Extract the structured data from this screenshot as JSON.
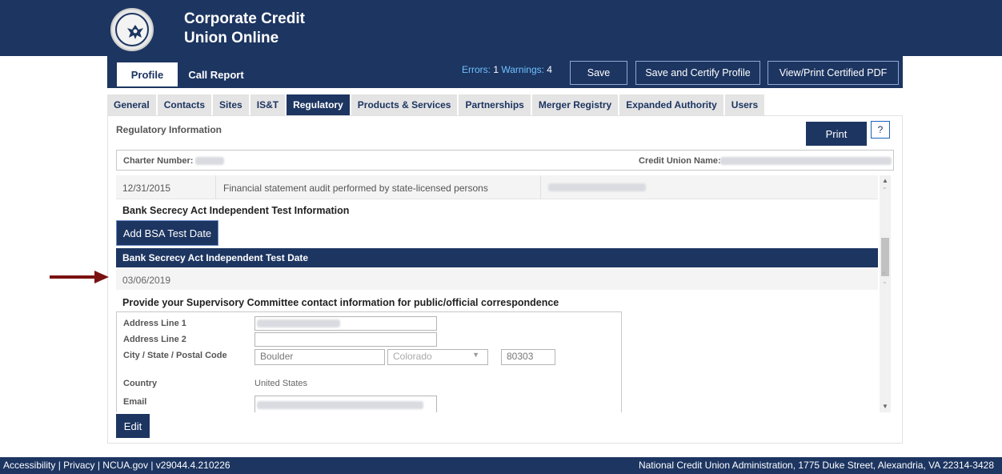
{
  "header": {
    "title_line1": "Corporate Credit",
    "title_line2": "Union Online",
    "tabs": [
      {
        "label": "Profile"
      },
      {
        "label": "Call Report"
      }
    ],
    "errors_label": "Errors:",
    "errors_count": "1",
    "warnings_label": "Warnings:",
    "warnings_count": "4",
    "save_label": "Save",
    "save_certify_label": "Save and Certify Profile",
    "view_print_label": "View/Print Certified PDF"
  },
  "subtabs": [
    {
      "label": "General"
    },
    {
      "label": "Contacts"
    },
    {
      "label": "Sites"
    },
    {
      "label": "IS&T"
    },
    {
      "label": "Regulatory"
    },
    {
      "label": "Products & Services"
    },
    {
      "label": "Partnerships"
    },
    {
      "label": "Merger Registry"
    },
    {
      "label": "Expanded Authority"
    },
    {
      "label": "Users"
    }
  ],
  "panel": {
    "section_title": "Regulatory Information",
    "print_label": "Print",
    "help_label": "?",
    "charter_label": "Charter Number:",
    "cu_name_label": "Credit Union Name:",
    "audit_row": {
      "date": "12/31/2015",
      "text": "Financial statement audit performed by state-licensed persons"
    },
    "bsa_heading": "Bank Secrecy Act Independent Test Information",
    "add_bsa_label": "Add BSA Test Date",
    "bsa_column": "Bank Secrecy Act Independent Test Date",
    "bsa_date": "03/06/2019",
    "supervisory_heading": "Provide your Supervisory Committee contact information for public/official correspondence",
    "fields": {
      "address1_label": "Address Line 1",
      "address2_label": "Address Line 2",
      "city_state_label": "City / State / Postal Code",
      "city_value": "Boulder",
      "state_value": "Colorado",
      "postal_value": "80303",
      "country_label": "Country",
      "country_value": "United States",
      "email_label": "Email"
    },
    "edit_label": "Edit"
  },
  "footer": {
    "left_links": [
      "Accessibility",
      "Privacy",
      "NCUA.gov"
    ],
    "version": "v29044.4.210226",
    "right_text": "National Credit Union Administration, 1775 Duke Street, Alexandria, VA 22314-3428"
  },
  "colors": {
    "brand_navy": "#1d3561",
    "annotation_arrow": "#7a1111",
    "errors_blue": "#6fc0ff"
  }
}
